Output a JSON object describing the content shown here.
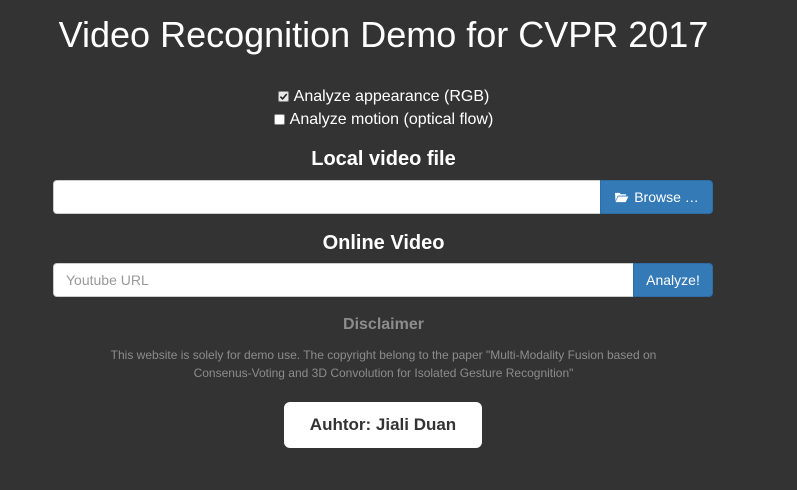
{
  "header": {
    "title": "Video Recognition Demo for CVPR 2017"
  },
  "options": {
    "appearance": {
      "label": "Analyze appearance (RGB)",
      "checked": true
    },
    "motion": {
      "label": "Analyze motion (optical flow)",
      "checked": false
    }
  },
  "local_video": {
    "heading": "Local video file",
    "value": "",
    "browse_label": "Browse …",
    "browse_icon": "folder-open-icon"
  },
  "online_video": {
    "heading": "Online Video",
    "placeholder": "Youtube URL",
    "analyze_label": "Analyze!"
  },
  "disclaimer": {
    "heading": "Disclaimer",
    "text": "This website is solely for demo use. The copyright belong to the paper \"Multi-Modality Fusion based on Consenus-Voting and 3D Convolution for Isolated Gesture Recognition\""
  },
  "author": {
    "label": "Auhtor: Jiali Duan"
  },
  "colors": {
    "background": "#333333",
    "button_primary": "#337ab7",
    "muted_text": "#8c8c8c"
  }
}
